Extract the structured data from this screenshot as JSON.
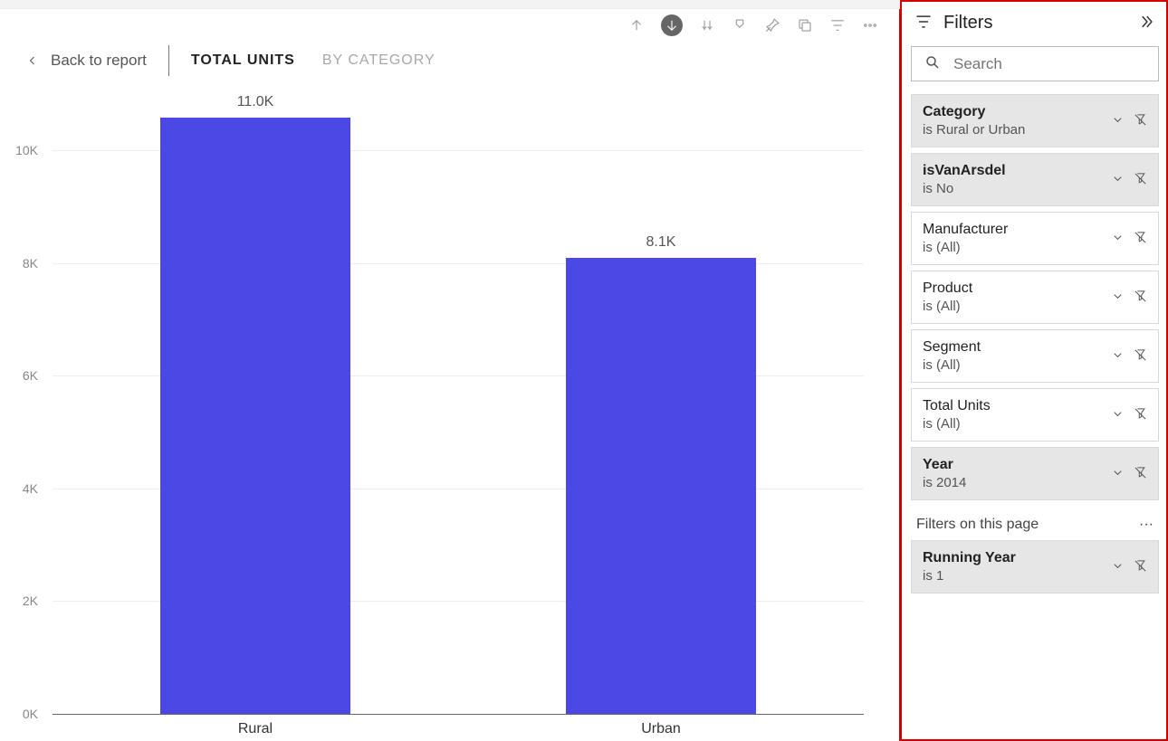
{
  "header": {
    "back": "Back to report",
    "tabs": [
      "TOTAL UNITS",
      "BY CATEGORY"
    ],
    "active_tab": 0
  },
  "chart_data": {
    "type": "bar",
    "categories": [
      "Rural",
      "Urban"
    ],
    "values": [
      11000,
      8100
    ],
    "value_labels": [
      "11.0K",
      "8.1K"
    ],
    "title": "",
    "xlabel": "",
    "ylabel": "",
    "ylim": [
      0,
      11000
    ],
    "y_ticks": [
      0,
      2000,
      4000,
      6000,
      8000,
      10000
    ],
    "y_tick_labels": [
      "0K",
      "2K",
      "4K",
      "6K",
      "8K",
      "10K"
    ],
    "bar_color": "#4B48E5"
  },
  "filters_panel": {
    "title": "Filters",
    "search_placeholder": "Search",
    "cards": [
      {
        "name": "Category",
        "value": "is Rural or Urban",
        "applied": true
      },
      {
        "name": "isVanArsdel",
        "value": "is No",
        "applied": true
      },
      {
        "name": "Manufacturer",
        "value": "is (All)",
        "applied": false
      },
      {
        "name": "Product",
        "value": "is (All)",
        "applied": false
      },
      {
        "name": "Segment",
        "value": "is (All)",
        "applied": false
      },
      {
        "name": "Total Units",
        "value": "is (All)",
        "applied": false
      },
      {
        "name": "Year",
        "value": "is 2014",
        "applied": true
      }
    ],
    "page_section_label": "Filters on this page",
    "page_cards": [
      {
        "name": "Running Year",
        "value": "is 1",
        "applied": true
      }
    ]
  }
}
